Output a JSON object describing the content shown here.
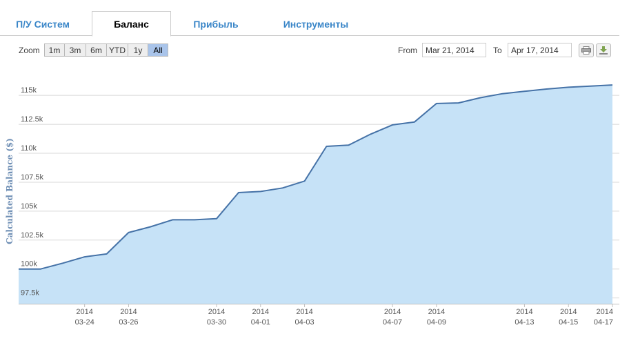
{
  "tabs": [
    {
      "label": "П/У Систем",
      "active": false
    },
    {
      "label": "Баланс",
      "active": true
    },
    {
      "label": "Прибыль",
      "active": false
    },
    {
      "label": "Инструменты",
      "active": false
    }
  ],
  "toolbar": {
    "zoom_label": "Zoom",
    "zoom_buttons": [
      "1m",
      "3m",
      "6m",
      "YTD",
      "1y",
      "All"
    ],
    "zoom_selected": "All",
    "from_label": "From",
    "from_value": "Mar 21, 2014",
    "to_label": "To",
    "to_value": "Apr 17, 2014",
    "print_icon": "printer-icon",
    "download_icon": "download-icon"
  },
  "colors": {
    "tab_text": "#3a86c8",
    "line": "#4572a7",
    "area_fill": "#c6e2f7",
    "grid": "#d8d8d8",
    "axis_title": "#6f8fb5",
    "zoom_selected": "#a9c4ea"
  },
  "chart_data": {
    "type": "area",
    "ylabel": "Calculated Balance ($)",
    "ylim": [
      97000,
      116800
    ],
    "yticks": [
      97500,
      100000,
      102500,
      105000,
      107500,
      110000,
      112500,
      115000
    ],
    "ytick_labels": [
      "97.5k",
      "100k",
      "102.5k",
      "105k",
      "107.5k",
      "110k",
      "112.5k",
      "115k"
    ],
    "xlim": [
      "2014-03-21",
      "2014-04-17"
    ],
    "xticks": [
      {
        "date": "2014-03-24",
        "year": "2014",
        "label": "03-24"
      },
      {
        "date": "2014-03-26",
        "year": "2014",
        "label": "03-26"
      },
      {
        "date": "2014-03-30",
        "year": "2014",
        "label": "03-30"
      },
      {
        "date": "2014-04-01",
        "year": "2014",
        "label": "04-01"
      },
      {
        "date": "2014-04-03",
        "year": "2014",
        "label": "04-03"
      },
      {
        "date": "2014-04-07",
        "year": "2014",
        "label": "04-07"
      },
      {
        "date": "2014-04-09",
        "year": "2014",
        "label": "04-09"
      },
      {
        "date": "2014-04-13",
        "year": "2014",
        "label": "04-13"
      },
      {
        "date": "2014-04-15",
        "year": "2014",
        "label": "04-15"
      },
      {
        "date": "2014-04-17",
        "year": "2014",
        "label": "04-17"
      }
    ],
    "x": [
      "2014-03-21",
      "2014-03-22",
      "2014-03-23",
      "2014-03-24",
      "2014-03-25",
      "2014-03-26",
      "2014-03-27",
      "2014-03-28",
      "2014-03-29",
      "2014-03-30",
      "2014-03-31",
      "2014-04-01",
      "2014-04-02",
      "2014-04-03",
      "2014-04-04",
      "2014-04-05",
      "2014-04-06",
      "2014-04-07",
      "2014-04-08",
      "2014-04-09",
      "2014-04-10",
      "2014-04-11",
      "2014-04-12",
      "2014-04-13",
      "2014-04-14",
      "2014-04-15",
      "2014-04-16",
      "2014-04-17"
    ],
    "values": [
      100000,
      100000,
      100500,
      101050,
      101300,
      103150,
      103650,
      104250,
      104250,
      104350,
      106600,
      106700,
      107000,
      107600,
      110600,
      110700,
      111650,
      112450,
      112700,
      114300,
      114350,
      114800,
      115150,
      115350,
      115550,
      115700,
      115800,
      115900
    ],
    "grid": true,
    "legend": "none"
  }
}
